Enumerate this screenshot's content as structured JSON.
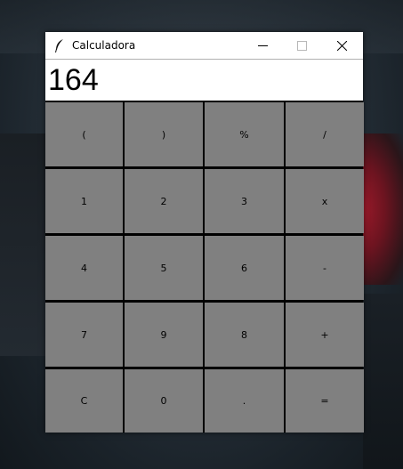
{
  "window": {
    "title": "Calculadora",
    "icon": "feather-icon",
    "controls": [
      "minimize-icon",
      "maximize-icon",
      "close-icon"
    ]
  },
  "display": {
    "value": "164"
  },
  "keypad": {
    "rows": [
      [
        "(",
        ")",
        "%",
        "/"
      ],
      [
        "1",
        "2",
        "3",
        "x"
      ],
      [
        "4",
        "5",
        "6",
        "-"
      ],
      [
        "7",
        "9",
        "8",
        "+"
      ],
      [
        "C",
        "0",
        ".",
        "="
      ]
    ]
  },
  "colors": {
    "key_background": "#808080",
    "window_background": "#000000",
    "titlebar": "#ffffff"
  }
}
